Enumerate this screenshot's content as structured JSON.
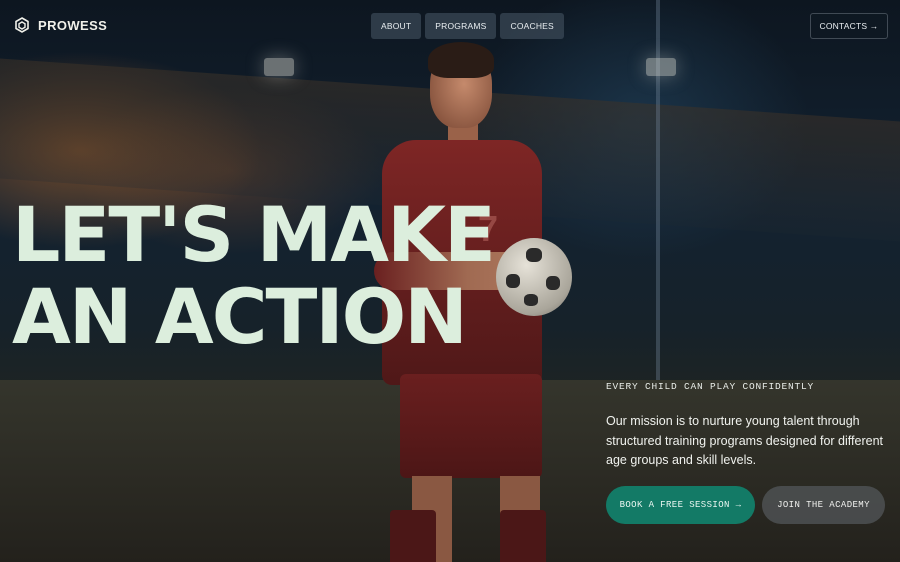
{
  "brand": {
    "name": "PROWESS",
    "icon": "hexagon-logo-icon"
  },
  "nav": {
    "items": [
      {
        "label": "ABOUT"
      },
      {
        "label": "PROGRAMS"
      },
      {
        "label": "COACHES"
      }
    ],
    "contacts_label": "CONTACTS →"
  },
  "hero": {
    "headline_line1": "LET'S MAKE",
    "headline_line2": "AN ACTION",
    "tagline": "EVERY CHILD CAN PLAY CONFIDENTLY",
    "mission": "Our mission is to nurture young talent through structured training programs designed for different age groups and skill levels.",
    "primary_cta": "BOOK A FREE SESSION →",
    "secondary_cta": "JOIN THE ACADEMY",
    "jersey_number": "7"
  },
  "colors": {
    "headline": "#dceedd",
    "primary_button": "#137a66",
    "secondary_button": "#505456",
    "jersey": "#7e2625"
  }
}
